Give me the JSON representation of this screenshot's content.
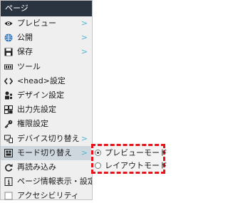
{
  "menu": {
    "title": "ページ",
    "arrow_glyph": ">",
    "items": [
      {
        "label": "プレビュー",
        "icon": "eye-icon",
        "has_submenu": true
      },
      {
        "label": "公開",
        "icon": "globe-icon",
        "has_submenu": true
      },
      {
        "label": "保存",
        "icon": "save-icon",
        "has_submenu": true
      },
      {
        "label": "ツール",
        "icon": "toolbar-icon",
        "has_submenu": false
      },
      {
        "label": "<head>設定",
        "icon": "code-icon",
        "has_submenu": false
      },
      {
        "label": "デザイン設定",
        "icon": "design-icon",
        "has_submenu": false
      },
      {
        "label": "出力先設定",
        "icon": "output-icon",
        "has_submenu": false
      },
      {
        "label": "権限設定",
        "icon": "key-icon",
        "has_submenu": false
      },
      {
        "label": "デバイス切り替え",
        "icon": "device-icon",
        "has_submenu": true
      },
      {
        "label": "モード切り替え",
        "icon": "mode-icon",
        "has_submenu": true
      },
      {
        "label": "再読み込み",
        "icon": "reload-icon",
        "has_submenu": false
      },
      {
        "label": "ページ情報表示・設定",
        "icon": "info-icon",
        "has_submenu": false
      },
      {
        "label": "アクセシビリティ",
        "icon": "checkbox-icon",
        "has_submenu": false
      }
    ]
  },
  "submenu": {
    "options": [
      {
        "label": "プレビューモード",
        "selected": true
      },
      {
        "label": "レイアウトモード",
        "selected": false
      }
    ]
  },
  "colors": {
    "header_bg": "#2a3440",
    "menu_bg": "#efefef",
    "active_bg": "#cfd7de",
    "arrow": "#4fb7d4",
    "highlight_border": "#e5141a"
  }
}
